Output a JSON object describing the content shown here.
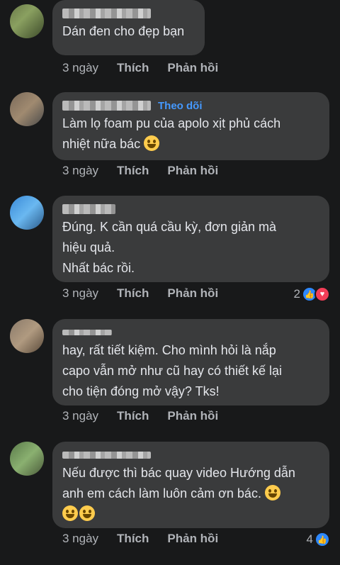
{
  "comments": [
    {
      "text": "Dán đen cho đẹp bạn",
      "time": "3 ngày",
      "like_label": "Thích",
      "reply_label": "Phản hồi"
    },
    {
      "follow_label": "Theo dõi",
      "text": "Làm lọ foam pu của apolo xịt phủ cách\nnhiệt nữa bác",
      "time": "3 ngày",
      "like_label": "Thích",
      "reply_label": "Phản hồi"
    },
    {
      "text": "Đúng. K cần quá cầu kỳ, đơn giản mà\nhiệu quả.\nNhất bác rồi.",
      "time": "3 ngày",
      "like_label": "Thích",
      "reply_label": "Phản hồi",
      "reaction_count": "2",
      "reactions": [
        "like-icon",
        "love-icon"
      ]
    },
    {
      "text": "hay, rất tiết kiệm. Cho mình hỏi là nắp\ncapo vẫn mở như cũ hay có thiết kế lại\ncho tiện đóng mở vậy? Tks!",
      "time": "3 ngày",
      "like_label": "Thích",
      "reply_label": "Phản hồi"
    },
    {
      "text": "Nếu được thì bác quay video Hướng dẫn\nanh em cách làm luôn cảm ơn bác.",
      "time": "3 ngày",
      "like_label": "Thích",
      "reply_label": "Phản hồi",
      "reaction_count": "4",
      "reactions": [
        "like-icon"
      ]
    }
  ],
  "colors": {
    "background": "#18191a",
    "bubble": "#3a3b3c",
    "link": "#4599ff",
    "muted": "#b0b3b8"
  }
}
